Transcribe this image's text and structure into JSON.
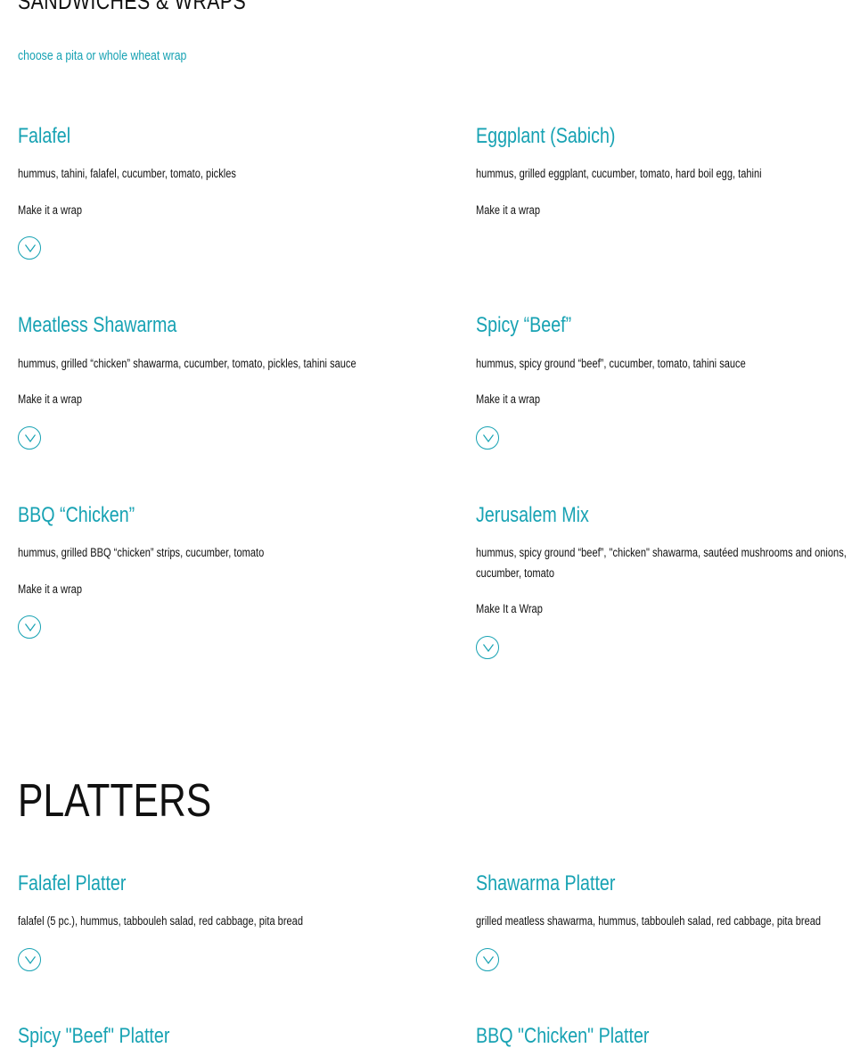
{
  "header": {
    "cut_title": "SANDWICHES & WRAPS",
    "subtitle": "choose a pita or whole wheat wrap"
  },
  "sandwiches": [
    {
      "name": "Falafel",
      "desc": "hummus, tahini, falafel, cucumber, tomato, pickles",
      "option": "Make it a wrap"
    },
    {
      "name": "Eggplant (Sabich)",
      "desc": "hummus, grilled eggplant, cucumber, tomato, hard boil egg, tahini",
      "option": "Make it a wrap"
    },
    {
      "name": "Meatless Shawarma",
      "desc": "hummus, grilled “chicken” shawarma, cucumber, tomato, pickles, tahini sauce",
      "option": "Make it a wrap"
    },
    {
      "name": "Spicy “Beef”",
      "desc": "hummus, spicy ground “beef”, cucumber, tomato, tahini sauce",
      "option": "Make it a wrap"
    },
    {
      "name": "BBQ “Chicken”",
      "desc": "hummus, grilled BBQ “chicken” strips, cucumber, tomato",
      "option": "Make it a wrap"
    },
    {
      "name": "Jerusalem Mix",
      "desc": "hummus, spicy ground “beef”, \"chicken\" shawarma, sautéed mushrooms and onions, cucumber, tomato",
      "option": "Make It a Wrap"
    }
  ],
  "platters_section": {
    "title": "PLATTERS",
    "items": [
      {
        "name": "Falafel Platter",
        "desc": "falafel (5 pc.), hummus, tabbouleh salad, red cabbage, pita bread"
      },
      {
        "name": "Shawarma Platter",
        "desc": "grilled meatless shawarma, hummus, tabbouleh salad, red cabbage, pita bread"
      },
      {
        "name": "Spicy \"Beef\" Platter"
      },
      {
        "name": "BBQ \"Chicken\" Platter"
      }
    ]
  },
  "icons": {
    "expand": "chevron-down-circle-icon"
  },
  "colors": {
    "accent": "#17a2b3",
    "text": "#111111",
    "background": "#ffffff"
  }
}
